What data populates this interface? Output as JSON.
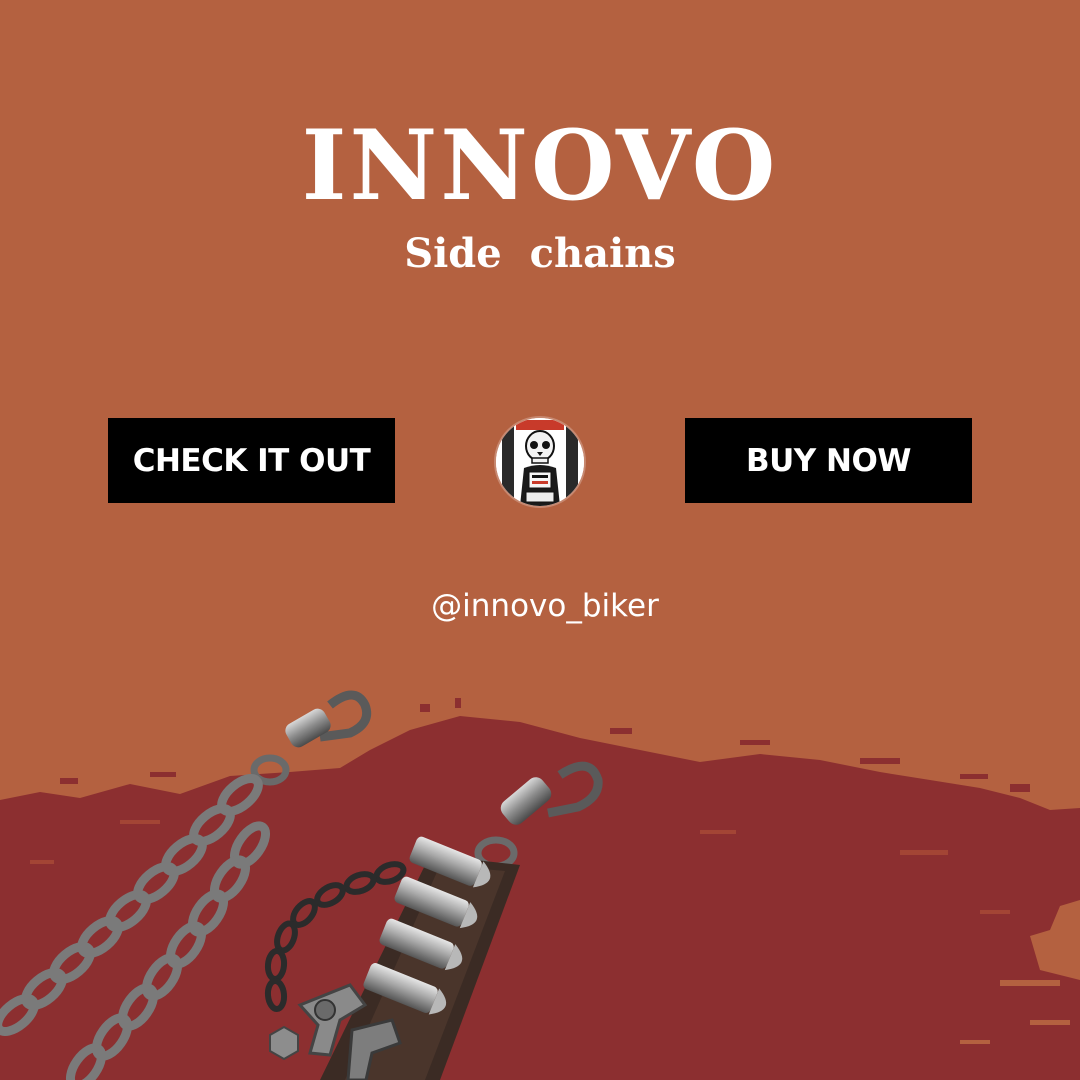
{
  "brand": {
    "name": "INNOVO",
    "tagline": "Side chains"
  },
  "buttons": {
    "check_it_out": "CHECK IT OUT",
    "buy_now": "BUY NOW"
  },
  "social": {
    "handle": "@innovo_biker"
  },
  "colors": {
    "background": "#b46140",
    "splash": "#8c2f30",
    "button_bg": "#000000",
    "text": "#ffffff"
  },
  "icons": {
    "avatar": "skull-avatar-icon",
    "product": "side-chain-product-image"
  }
}
